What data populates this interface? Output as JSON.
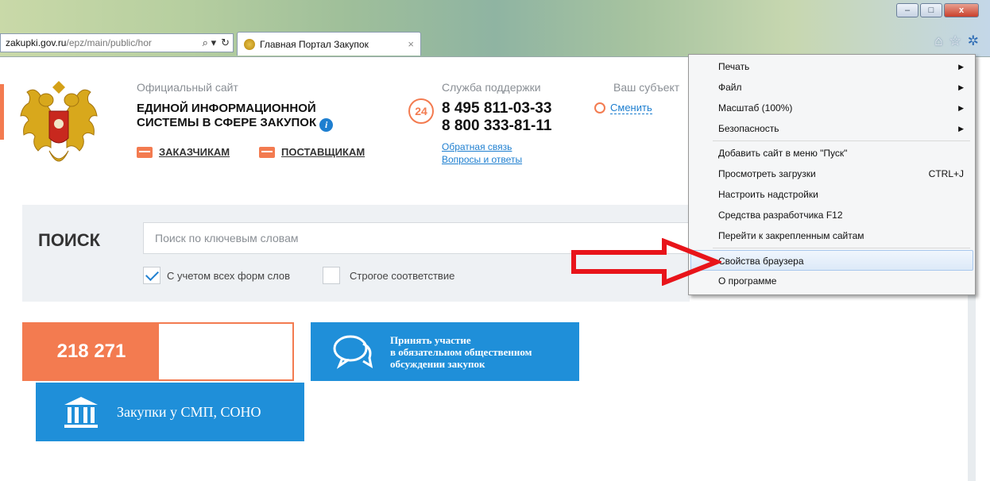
{
  "browser": {
    "url_host": "zakupki.gov.ru",
    "url_path": "/epz/main/public/hor",
    "tab_title": "Главная Портал Закупок",
    "tab_close": "×",
    "search_glyph": "⌕ ▾",
    "refresh_glyph": "↻",
    "window_controls": {
      "minimize": "–",
      "maximize": "□",
      "close": "x"
    },
    "icons": {
      "home": "⌂",
      "favorites": "☆",
      "tools": "✲"
    }
  },
  "header": {
    "official_label": "Официальный сайт",
    "official_name_line1": "ЕДИНОЙ ИНФОРМАЦИОННОЙ",
    "official_name_line2": "СИСТЕМЫ В СФЕРЕ ЗАКУПОК",
    "info_glyph": "i",
    "nav": {
      "customers": "ЗАКАЗЧИКАМ",
      "suppliers": "ПОСТАВЩИКАМ"
    },
    "support": {
      "label": "Служба поддержки",
      "badge": "24",
      "phone1": "8 495 811-03-33",
      "phone2": "8 800 333-81-11",
      "feedback": "Обратная связь",
      "faq": "Вопросы и ответы"
    },
    "region": {
      "label": "Ваш субъект",
      "change": "Сменить"
    }
  },
  "search": {
    "title": "ПОИСК",
    "placeholder": "Поиск по ключевым словам",
    "option_all_forms": "С учетом всех форм слов",
    "option_all_forms_checked": true,
    "option_strict": "Строгое соответствие",
    "option_strict_checked": false
  },
  "tiles": {
    "counter_value": "218 271",
    "discussion_line1": "Принять участие",
    "discussion_line2": "в обязательном общественном",
    "discussion_line3": "обсуждении закупок",
    "smp_label": "Закупки у СМП, СОНО"
  },
  "menu": {
    "items": [
      {
        "label": "Печать",
        "submenu": true
      },
      {
        "label": "Файл",
        "submenu": true
      },
      {
        "label": "Масштаб (100%)",
        "submenu": true
      },
      {
        "label": "Безопасность",
        "submenu": true
      },
      {
        "label": "Добавить сайт в меню \"Пуск\""
      },
      {
        "label": "Просмотреть загрузки",
        "shortcut": "CTRL+J"
      },
      {
        "label": "Настроить надстройки"
      },
      {
        "label": "Средства разработчика F12"
      },
      {
        "label": "Перейти к закрепленным сайтам"
      },
      {
        "label": "Свойства браузера",
        "highlighted": true
      },
      {
        "label": "О программе"
      }
    ],
    "submenu_glyph": "▶"
  },
  "colors": {
    "accent_orange": "#f37b50",
    "accent_blue": "#1f8fd9",
    "link_blue": "#1e7fd0",
    "annotation_red": "#e8141a"
  }
}
